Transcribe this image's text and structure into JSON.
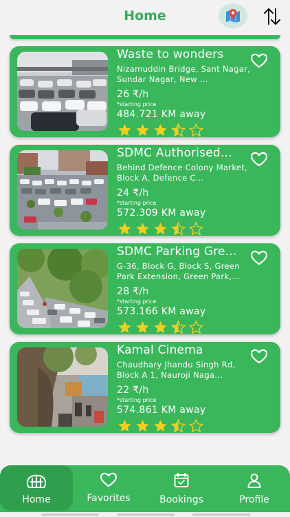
{
  "header": {
    "title": "Home",
    "map_icon": "map-pin-icon",
    "sort_icon": "sort-arrows-icon"
  },
  "cards": [
    {
      "name": "Waste to wonders",
      "address": "Nizamuddin Bridge, Sant Nagar, Sundar Nagar, New ...",
      "price": "26 ₹/h",
      "price_note": "*starting price",
      "distance": "484.721 KM away",
      "rating": 3.5
    },
    {
      "name": "SDMC Authorised...",
      "address": "Behind Defence Colony Market, Block A, Defence C...",
      "price": "24 ₹/h",
      "price_note": "*starting price",
      "distance": "572.309 KM away",
      "rating": 3.5
    },
    {
      "name": "SDMC Parking Gre...",
      "address": "G-36, Block G, Block S, Green Park Extension, Green Park,...",
      "price": "28 ₹/h",
      "price_note": "*starting price",
      "distance": "573.166 KM away",
      "rating": 3.5
    },
    {
      "name": "Kamal Cinema",
      "address": "Chaudhary Jhandu Singh Rd, Block A 1, Nauroji Naga...",
      "price": "22 ₹/h",
      "price_note": "*starting price",
      "distance": "574.861 KM away",
      "rating": 3.5
    }
  ],
  "nav": {
    "home": "Home",
    "favorites": "Favorites",
    "bookings": "Bookings",
    "profile": "Profile"
  },
  "colors": {
    "accent": "#3ab65b",
    "title": "#3aaa5a",
    "star": "#f7cf1e"
  }
}
